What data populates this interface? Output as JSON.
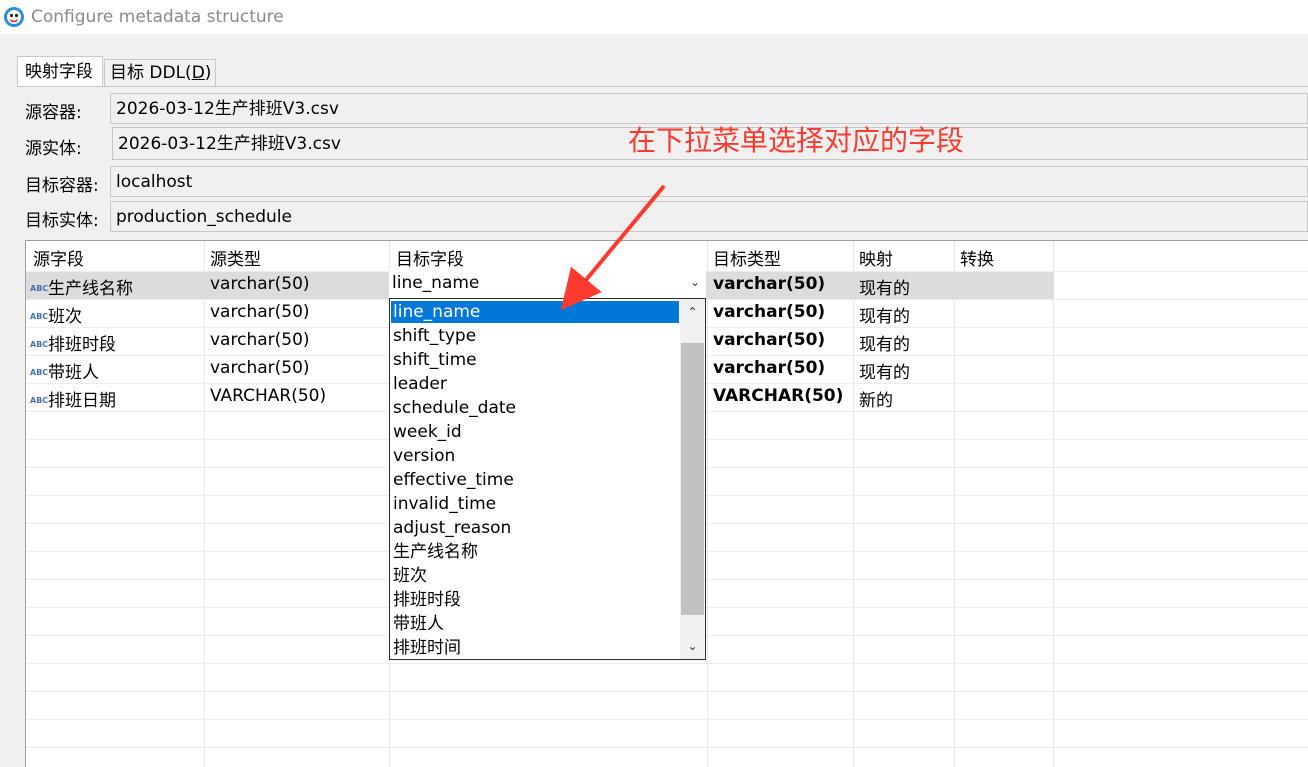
{
  "window": {
    "title": "Configure metadata structure"
  },
  "tabs": [
    {
      "label": "映射字段",
      "active": true
    },
    {
      "label": "目标 DDL(",
      "mnemonic": "D",
      "suffix": ")"
    }
  ],
  "form": {
    "source_container": {
      "label": "源容器:",
      "value": "2026-03-12生产排班V3.csv"
    },
    "source_entity": {
      "label": "源实体:",
      "value": "2026-03-12生产排班V3.csv"
    },
    "target_container": {
      "label": "目标容器:",
      "value": "localhost"
    },
    "target_entity": {
      "label": "目标实体:",
      "value": "production_schedule"
    }
  },
  "annotation": {
    "text": "在下拉菜单选择对应的字段",
    "color": "#ff3b2f"
  },
  "grid": {
    "headers": [
      "源字段",
      "源类型",
      "目标字段",
      "目标类型",
      "映射",
      "转换"
    ],
    "rows": [
      {
        "source_field": "生产线名称",
        "source_type": "varchar(50)",
        "target_field": "line_name",
        "target_type": "varchar(50)",
        "mapping": "现有的"
      },
      {
        "source_field": "班次",
        "source_type": "varchar(50)",
        "target_field": "",
        "target_type": "varchar(50)",
        "mapping": "现有的"
      },
      {
        "source_field": "排班时段",
        "source_type": "varchar(50)",
        "target_field": "",
        "target_type": "varchar(50)",
        "mapping": "现有的"
      },
      {
        "source_field": "带班人",
        "source_type": "varchar(50)",
        "target_field": "",
        "target_type": "varchar(50)",
        "mapping": "现有的"
      },
      {
        "source_field": "排班日期",
        "source_type": "VARCHAR(50)",
        "target_field": "",
        "target_type": "VARCHAR(50)",
        "mapping": "新的"
      }
    ],
    "row_icon": "abc-type-icon"
  },
  "dropdown": {
    "selected": "line_name",
    "options": [
      "line_name",
      "shift_type",
      "shift_time",
      "leader",
      "schedule_date",
      "week_id",
      "version",
      "effective_time",
      "invalid_time",
      "adjust_reason",
      "生产线名称",
      "班次",
      "排班时段",
      "带班人",
      "排班时间"
    ]
  }
}
